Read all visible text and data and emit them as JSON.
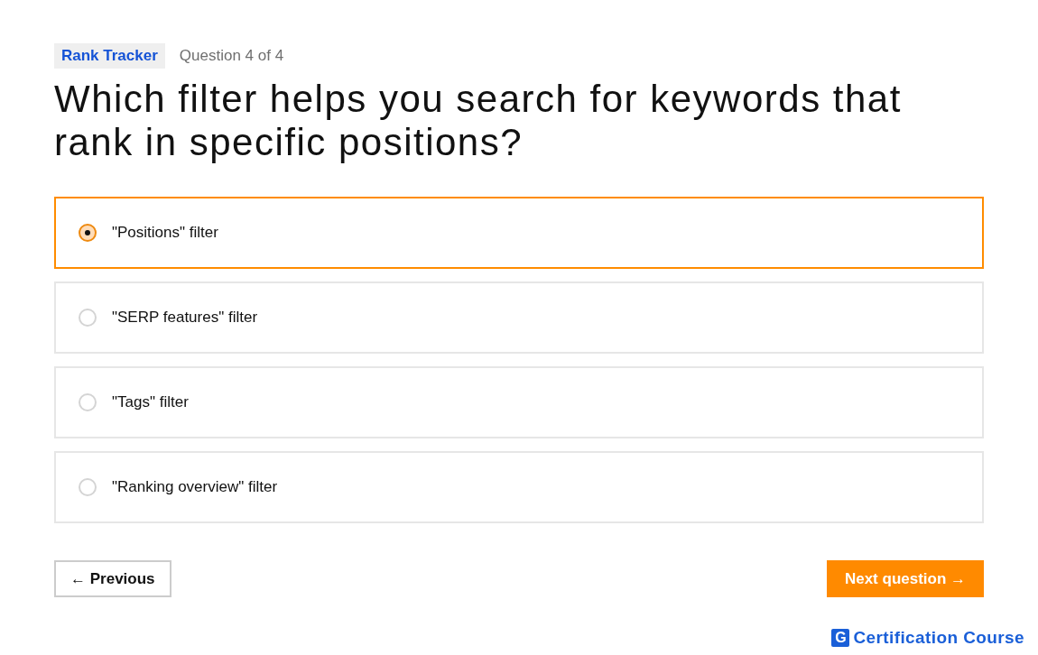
{
  "tag": "Rank Tracker",
  "progress": "Question 4 of 4",
  "question": "Which filter helps you search for keywords that rank in specific positions?",
  "options": [
    {
      "label": "\"Positions\" filter",
      "selected": true
    },
    {
      "label": "\"SERP features\" filter",
      "selected": false
    },
    {
      "label": "\"Tags\" filter",
      "selected": false
    },
    {
      "label": "\"Ranking overview\" filter",
      "selected": false
    }
  ],
  "buttons": {
    "previous": "← Previous",
    "next": "Next question →"
  },
  "logo": {
    "mark": "G",
    "name": "Certification Course"
  }
}
